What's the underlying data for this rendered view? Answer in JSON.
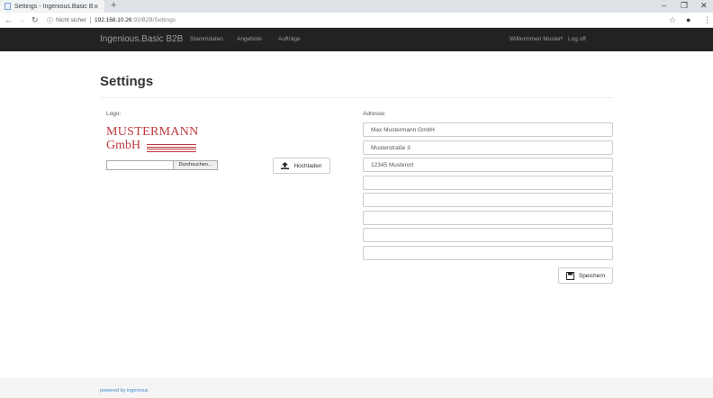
{
  "browser": {
    "tab_title": "Settings - Ingenious.Basic B2B",
    "tab_close": "✕",
    "new_tab": "+",
    "minimize": "–",
    "restore": "❐",
    "close": "✕",
    "security_label": "Nicht sicher",
    "url_host": "192.168.10.26",
    "url_path": ":92/B2B/Settings"
  },
  "navbar": {
    "brand": "Ingenious.Basic B2B",
    "links": [
      "Stammdaten",
      "Angebote",
      "Aufträge"
    ],
    "welcome": "Willkommen Musterf",
    "logoff": "Log off"
  },
  "page": {
    "title": "Settings",
    "logo_label": "Logo:",
    "logo_text_line1": "MUSTERMANN",
    "logo_text_line2": "GmbH",
    "browse_label": "Durchsuchen...",
    "upload_label": "Hochladen",
    "address_label": "Adresse:",
    "address_lines": [
      "Max Mustermann GmbH",
      "Musterstraße 3",
      "12345 Musterort",
      "",
      "",
      "",
      "",
      ""
    ],
    "save_label": "Speichern"
  },
  "footer": {
    "text": "powered by ingenious"
  }
}
